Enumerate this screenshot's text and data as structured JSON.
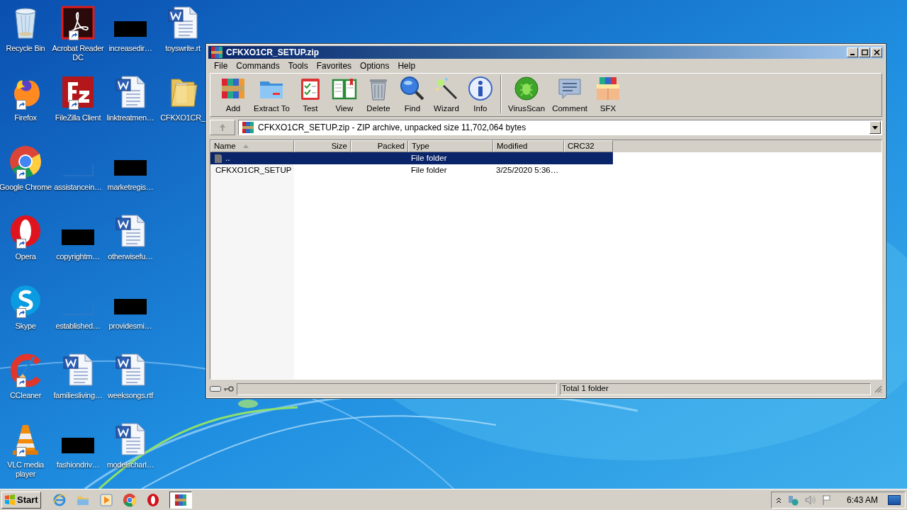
{
  "desktop": {
    "icons": [
      {
        "label": "Recycle Bin",
        "kind": "recycle",
        "shortcut": false
      },
      {
        "label": "Firefox",
        "kind": "firefox",
        "shortcut": true
      },
      {
        "label": "Google Chrome",
        "kind": "chrome",
        "shortcut": true
      },
      {
        "label": "Opera",
        "kind": "opera",
        "shortcut": true
      },
      {
        "label": "Skype",
        "kind": "skype",
        "shortcut": true
      },
      {
        "label": "CCleaner",
        "kind": "ccleaner",
        "shortcut": true
      },
      {
        "label": "VLC media player",
        "kind": "vlc",
        "shortcut": true
      },
      {
        "label": "Acrobat Reader DC",
        "kind": "acrobat",
        "shortcut": true
      },
      {
        "label": "FileZilla Client",
        "kind": "filezilla",
        "shortcut": true
      },
      {
        "label": "assistancein…",
        "kind": "blank",
        "shortcut": false
      },
      {
        "label": "copyrightm…",
        "kind": "redacted",
        "shortcut": false
      },
      {
        "label": "established…",
        "kind": "blank",
        "shortcut": false
      },
      {
        "label": "familiesliving…",
        "kind": "word",
        "shortcut": false
      },
      {
        "label": "fashiondriv…",
        "kind": "redacted",
        "shortcut": false
      },
      {
        "label": "increasedir…",
        "kind": "redacted",
        "shortcut": false
      },
      {
        "label": "linktreatmen…",
        "kind": "word",
        "shortcut": false
      },
      {
        "label": "marketregis…",
        "kind": "redacted",
        "shortcut": false
      },
      {
        "label": "otherwisefu…",
        "kind": "word",
        "shortcut": false
      },
      {
        "label": "providesmi…",
        "kind": "redacted",
        "shortcut": false
      },
      {
        "label": "weeksongs.rtf",
        "kind": "word",
        "shortcut": false
      },
      {
        "label": "modelscharl…",
        "kind": "word",
        "shortcut": false
      },
      {
        "label": "toyswrite.rt",
        "kind": "word",
        "shortcut": false
      },
      {
        "label": "CFKXO1CR_",
        "kind": "folder",
        "shortcut": false
      }
    ]
  },
  "window": {
    "title": "CFKXO1CR_SETUP.zip",
    "menu": [
      "File",
      "Commands",
      "Tools",
      "Favorites",
      "Options",
      "Help"
    ],
    "toolbar": [
      {
        "label": "Add",
        "kind": "add"
      },
      {
        "label": "Extract To",
        "kind": "extract"
      },
      {
        "label": "Test",
        "kind": "test"
      },
      {
        "label": "View",
        "kind": "view"
      },
      {
        "label": "Delete",
        "kind": "delete"
      },
      {
        "label": "Find",
        "kind": "find"
      },
      {
        "label": "Wizard",
        "kind": "wizard"
      },
      {
        "label": "Info",
        "kind": "info"
      },
      {
        "label": "VirusScan",
        "kind": "virus",
        "separator_before": true
      },
      {
        "label": "Comment",
        "kind": "comment"
      },
      {
        "label": "SFX",
        "kind": "sfx"
      }
    ],
    "address": "CFKXO1CR_SETUP.zip - ZIP archive, unpacked size 11,702,064 bytes",
    "table": {
      "columns": [
        {
          "label": "Name",
          "sorted": true
        },
        {
          "label": "Size",
          "sorted": false
        },
        {
          "label": "Packed",
          "sorted": false
        },
        {
          "label": "Type",
          "sorted": false
        },
        {
          "label": "Modified",
          "sorted": false
        },
        {
          "label": "CRC32",
          "sorted": false
        }
      ],
      "rows": [
        {
          "name": "..",
          "type": "File folder",
          "kind": "up",
          "selected": true
        },
        {
          "name": "CFKXO1CR_SETUP",
          "type": "File folder",
          "modified": "3/25/2020 5:36…",
          "kind": "folder",
          "selected": false
        }
      ]
    },
    "status_bar": "Total 1 folder"
  },
  "taskbar": {
    "start": "Start",
    "apps": [
      {
        "kind": "ie",
        "active": false
      },
      {
        "kind": "explorer",
        "active": false
      },
      {
        "kind": "media",
        "active": false
      },
      {
        "kind": "chrome",
        "active": false
      },
      {
        "kind": "opera",
        "active": false
      },
      {
        "kind": "winrar",
        "active": true
      }
    ],
    "clock": "6:43 AM"
  }
}
